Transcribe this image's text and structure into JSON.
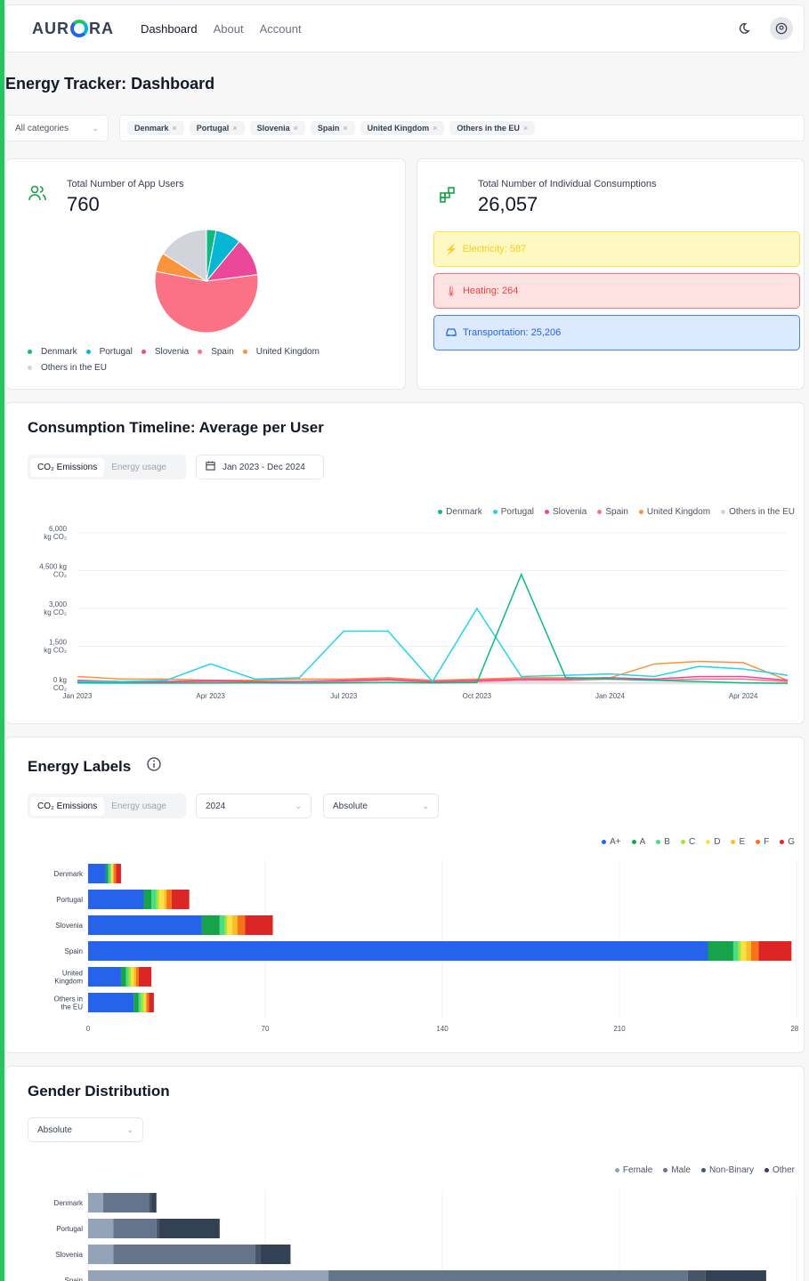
{
  "header": {
    "logo": "AUR RA",
    "logo_left": "AUR",
    "logo_right": "RA",
    "nav": [
      "Dashboard",
      "About",
      "Account"
    ],
    "moon_icon": "moon-icon",
    "user_icon": "user-circle-icon"
  },
  "page": {
    "title": "Energy Tracker: Dashboard"
  },
  "filters": {
    "category_select": "All categories",
    "countries": [
      "Denmark",
      "Portugal",
      "Slovenia",
      "Spain",
      "United Kingdom",
      "Others in the EU"
    ]
  },
  "users_card": {
    "label": "Total Number of App Users",
    "value": "760",
    "pie": [
      {
        "name": "Denmark",
        "value": 3,
        "color": "#10b981"
      },
      {
        "name": "Portugal",
        "value": 8,
        "color": "#06b6d4"
      },
      {
        "name": "Slovenia",
        "value": 12,
        "color": "#ec4899"
      },
      {
        "name": "Spain",
        "value": 55,
        "color": "#fb7185"
      },
      {
        "name": "United Kingdom",
        "value": 6,
        "color": "#fb923c"
      },
      {
        "name": "Others in the EU",
        "value": 16,
        "color": "#d1d5db"
      }
    ]
  },
  "consumptions_card": {
    "label": "Total Number of Individual Consumptions",
    "value": "26,057",
    "electricity": "Electricity: 587",
    "heating": "Heating: 264",
    "transportation": "Transportation: 25,206"
  },
  "timeline": {
    "title": "Consumption Timeline: Average per User",
    "tab_on": "CO₂ Emissions",
    "tab_off": "Energy usage",
    "date_range": "Jan 2023 - Dec 2024"
  },
  "energy_labels": {
    "title": "Energy Labels",
    "tab_on": "CO₂ Emissions",
    "tab_off": "Energy usage",
    "year": "2024",
    "mode": "Absolute"
  },
  "gender": {
    "title": "Gender Distribution",
    "mode": "Absolute"
  },
  "chart_data": [
    {
      "type": "line",
      "x": [
        "Jan 2023",
        "Feb 2023",
        "Mar 2023",
        "Apr 2023",
        "May 2023",
        "Jun 2023",
        "Jul 2023",
        "Aug 2023",
        "Sep 2023",
        "Oct 2023",
        "Nov 2023",
        "Dec 2023",
        "Jan 2024",
        "Feb 2024",
        "Mar 2024",
        "Apr 2024",
        "May 2024"
      ],
      "x_ticks": [
        "Jan 2023",
        "Apr 2023",
        "Jul 2023",
        "Oct 2023",
        "Jan 2024",
        "Apr 2024"
      ],
      "y_ticks": [
        {
          "v": 0,
          "l1": "0 kg",
          "l2": "CO₂"
        },
        {
          "v": 1500,
          "l1": "1,500",
          "l2": "kg CO₂"
        },
        {
          "v": 3000,
          "l1": "3,000",
          "l2": "kg CO₂"
        },
        {
          "v": 4500,
          "l1": "4,500 kg",
          "l2": "CO₂"
        },
        {
          "v": 6000,
          "l1": "6,000",
          "l2": "kg CO₂"
        }
      ],
      "ylim": [
        0,
        6000
      ],
      "series": [
        {
          "name": "Denmark",
          "color": "#10b981",
          "values": [
            50,
            40,
            40,
            40,
            50,
            40,
            50,
            60,
            50,
            60,
            4350,
            250,
            200,
            150,
            100,
            50,
            30
          ]
        },
        {
          "name": "Portugal",
          "color": "#22d3ee",
          "values": [
            100,
            100,
            150,
            800,
            200,
            250,
            2100,
            2100,
            100,
            3000,
            300,
            350,
            400,
            300,
            700,
            600,
            350
          ]
        },
        {
          "name": "Slovenia",
          "color": "#ec4899",
          "values": [
            150,
            100,
            100,
            150,
            100,
            100,
            150,
            200,
            100,
            150,
            200,
            200,
            250,
            200,
            300,
            300,
            150
          ]
        },
        {
          "name": "Spain",
          "color": "#fb7185",
          "values": [
            100,
            80,
            80,
            100,
            80,
            100,
            100,
            150,
            80,
            100,
            150,
            150,
            200,
            150,
            200,
            200,
            100
          ]
        },
        {
          "name": "United Kingdom",
          "color": "#fb923c",
          "values": [
            300,
            200,
            200,
            150,
            150,
            200,
            200,
            250,
            150,
            200,
            250,
            250,
            250,
            800,
            900,
            850,
            150
          ]
        },
        {
          "name": "Others in the EU",
          "color": "#d1d5db",
          "values": [
            50,
            50,
            50,
            50,
            50,
            50,
            50,
            50,
            50,
            50,
            50,
            50,
            50,
            50,
            50,
            50,
            50
          ]
        }
      ]
    },
    {
      "type": "bar",
      "title": "Energy Labels",
      "categories": [
        "Denmark",
        "Portugal",
        "Slovenia",
        "Spain",
        "United Kingdom",
        "Others in the EU"
      ],
      "x_ticks": [
        0,
        70,
        140,
        210,
        280
      ],
      "xlim": [
        0,
        280
      ],
      "series": [
        {
          "name": "A+",
          "color": "#2563eb",
          "values": [
            7,
            22,
            45,
            245,
            13,
            18
          ]
        },
        {
          "name": "A",
          "color": "#16a34a",
          "values": [
            1,
            3,
            7,
            10,
            2,
            2
          ]
        },
        {
          "name": "B",
          "color": "#4ade80",
          "values": [
            1,
            2,
            2,
            2,
            1,
            1
          ]
        },
        {
          "name": "C",
          "color": "#a3e635",
          "values": [
            0,
            1,
            1,
            1,
            1,
            1
          ]
        },
        {
          "name": "D",
          "color": "#fde047",
          "values": [
            1,
            2,
            2,
            2,
            1,
            1
          ]
        },
        {
          "name": "E",
          "color": "#fbbf24",
          "values": [
            0,
            1,
            2,
            2,
            1,
            0
          ]
        },
        {
          "name": "F",
          "color": "#f97316",
          "values": [
            1,
            2,
            3,
            3,
            1,
            1
          ]
        },
        {
          "name": "G",
          "color": "#dc2626",
          "values": [
            2,
            7,
            11,
            13,
            5,
            2
          ]
        }
      ]
    },
    {
      "type": "bar",
      "title": "Gender Distribution",
      "categories": [
        "Denmark",
        "Portugal",
        "Slovenia",
        "Spain"
      ],
      "xlim": [
        0,
        280
      ],
      "series": [
        {
          "name": "Female",
          "color": "#94a3b8",
          "values": [
            6,
            10,
            10,
            95
          ]
        },
        {
          "name": "Male",
          "color": "#64748b",
          "values": [
            18,
            17,
            56,
            142
          ]
        },
        {
          "name": "Non-Binary",
          "color": "#475569",
          "values": [
            1,
            1,
            2,
            7
          ]
        },
        {
          "name": "Other",
          "color": "#334155",
          "values": [
            2,
            24,
            12,
            24
          ]
        }
      ]
    }
  ]
}
